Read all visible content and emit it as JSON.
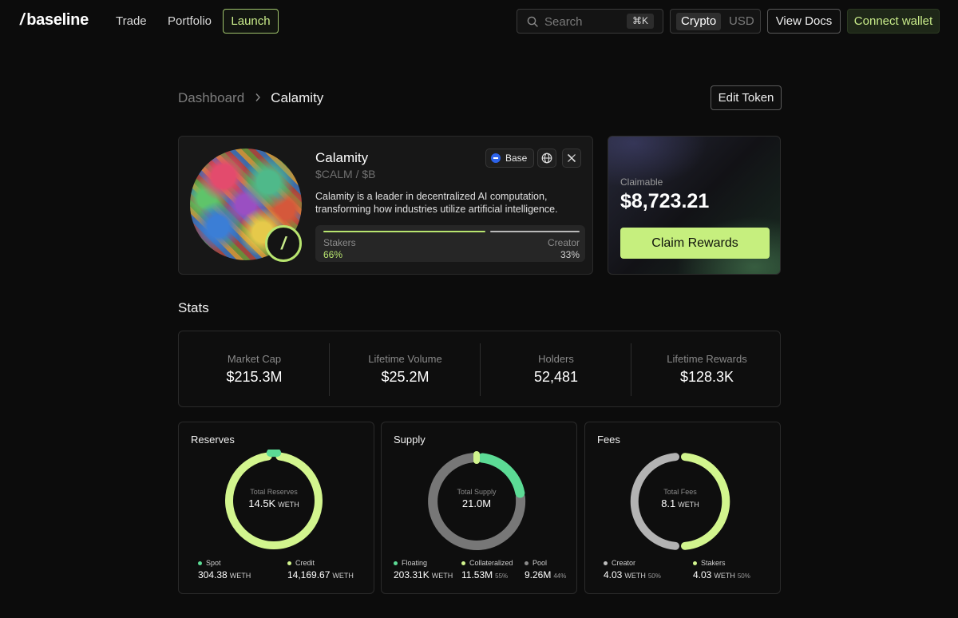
{
  "nav": {
    "logo": "baseline",
    "links": [
      "Trade",
      "Portfolio"
    ],
    "launch": "Launch",
    "search_placeholder": "Search",
    "search_shortcut": "⌘K",
    "currency_active": "Crypto",
    "currency_inactive": "USD",
    "view_docs": "View Docs",
    "connect_wallet": "Connect wallet"
  },
  "breadcrumb": {
    "parent": "Dashboard",
    "current": "Calamity"
  },
  "edit_token": "Edit Token",
  "token": {
    "name": "Calamity",
    "tickers": "$CALM  / $B",
    "chain": "Base",
    "description": "Calamity is a leader in decentralized AI computation, transforming how industries utilize artificial intelligence.",
    "split": {
      "left_label": "Stakers",
      "left_value": "66%",
      "left_fraction": 0.66,
      "right_label": "Creator",
      "right_value": "33%"
    },
    "icons": {
      "globe": "globe-icon",
      "x": "x-icon",
      "badge": "baseline-logo-icon"
    }
  },
  "claim": {
    "label": "Claimable",
    "value": "$8,723.21",
    "button": "Claim Rewards"
  },
  "stats_title": "Stats",
  "stats": [
    {
      "label": "Market Cap",
      "value": "$215.3M"
    },
    {
      "label": "Lifetime Volume",
      "value": "$25.2M"
    },
    {
      "label": "Holders",
      "value": "52,481"
    },
    {
      "label": "Lifetime Rewards",
      "value": "$128.3K"
    }
  ],
  "cards": {
    "reserves": {
      "title": "Reserves",
      "center_label": "Total Reserves",
      "center_value": "14.5K",
      "center_unit": "WETH",
      "legend": [
        {
          "label": "Spot",
          "value": "304.38",
          "unit": "WETH",
          "color": "#5cdb95"
        },
        {
          "label": "Credit",
          "value": "14,169.67",
          "unit": "WETH",
          "color": "#d2f58e"
        }
      ]
    },
    "supply": {
      "title": "Supply",
      "center_label": "Total Supply",
      "center_value": "21.0M",
      "legend": [
        {
          "label": "Floating",
          "value": "203.31K",
          "unit": "WETH",
          "color": "#5cdb95"
        },
        {
          "label": "Collateralized",
          "value": "11.53M",
          "pct": "55%",
          "color": "#d2f58e"
        },
        {
          "label": "Pool",
          "value": "9.26M",
          "pct": "44%",
          "color": "#8a8a8a"
        }
      ]
    },
    "fees": {
      "title": "Fees",
      "center_label": "Total Fees",
      "center_value": "8.1",
      "center_unit": "WETH",
      "legend": [
        {
          "label": "Creator",
          "value": "4.03",
          "unit": "WETH",
          "pct": "50%",
          "color": "#bdbdbd"
        },
        {
          "label": "Stakers",
          "value": "4.03",
          "unit": "WETH",
          "pct": "50%",
          "color": "#d2f58e"
        }
      ]
    }
  }
}
